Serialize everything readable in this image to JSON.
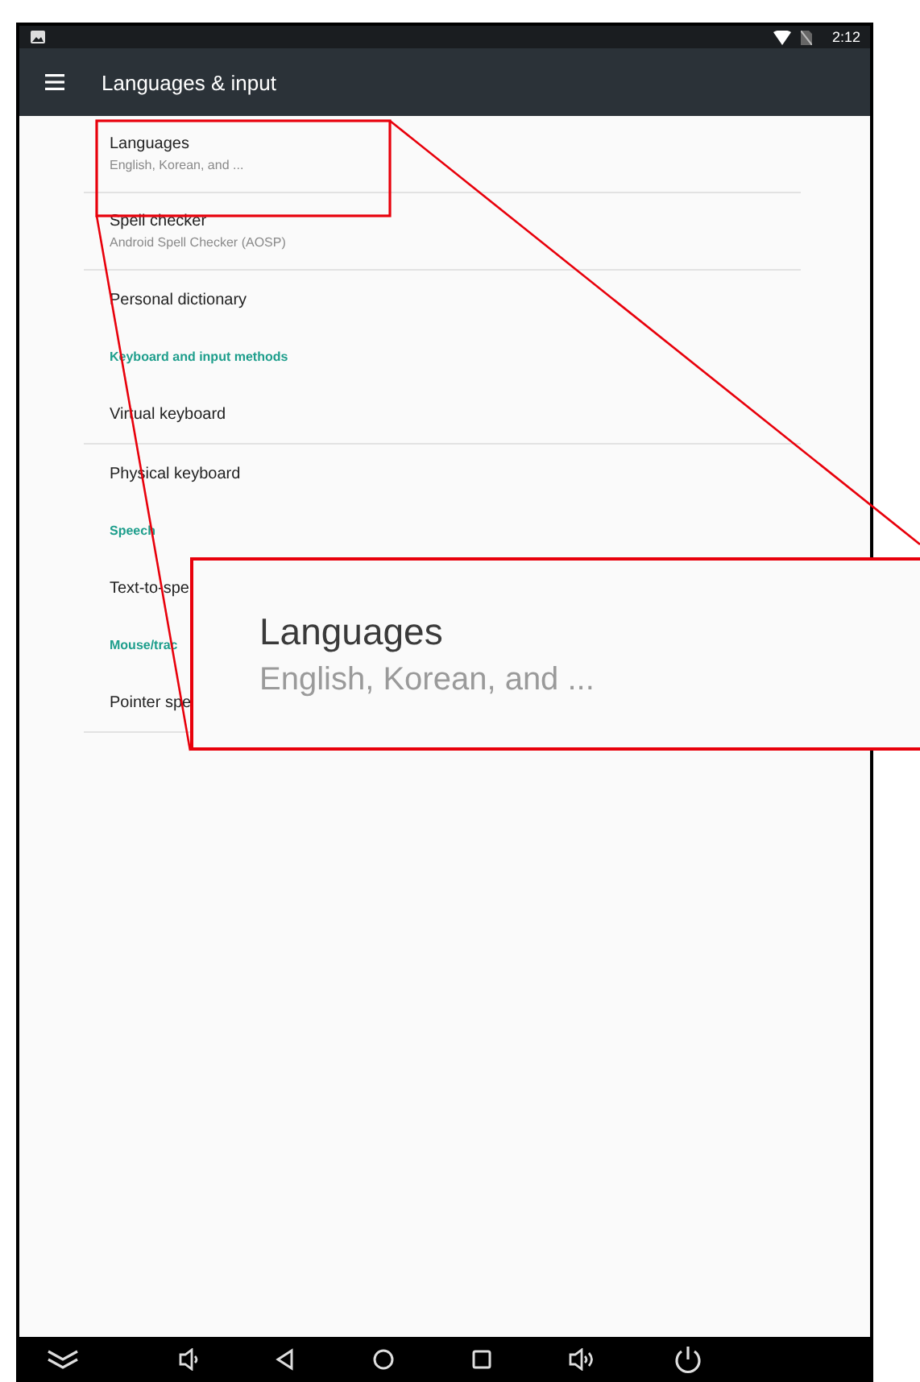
{
  "status_bar": {
    "time": "2:12"
  },
  "app_bar": {
    "title": "Languages & input"
  },
  "items": [
    {
      "kind": "item",
      "title": "Languages",
      "subtitle": "English, Korean, and ..."
    },
    {
      "kind": "divider"
    },
    {
      "kind": "item",
      "title": "Spell checker",
      "subtitle": "Android Spell Checker (AOSP)"
    },
    {
      "kind": "divider"
    },
    {
      "kind": "item",
      "title": "Personal dictionary"
    },
    {
      "kind": "category",
      "title": "Keyboard and input methods"
    },
    {
      "kind": "item",
      "title": "Virtual keyboard"
    },
    {
      "kind": "divider"
    },
    {
      "kind": "item",
      "title": "Physical keyboard"
    },
    {
      "kind": "category",
      "title": "Speech"
    },
    {
      "kind": "item",
      "title": "Text-to-spe"
    },
    {
      "kind": "category",
      "title": "Mouse/trac"
    },
    {
      "kind": "item",
      "title": "Pointer spe"
    },
    {
      "kind": "divider"
    }
  ],
  "callout": {
    "title": "Languages",
    "subtitle": "English, Korean, and ..."
  }
}
